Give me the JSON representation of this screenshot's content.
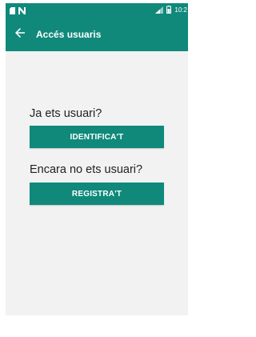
{
  "status_bar": {
    "time": "10:2",
    "icons": [
      "sd-card-icon",
      "no-signal-icon",
      "signal-icon",
      "battery-icon"
    ]
  },
  "app_bar": {
    "back_icon": "arrow-left-icon",
    "title": "Accés usuaris"
  },
  "login_section": {
    "label": "Ja ets usuari?",
    "button_label": "IDENTIFICA'T"
  },
  "register_section": {
    "label": "Encara no ets usuari?",
    "button_label": "REGISTRA'T"
  },
  "colors": {
    "primary": "#10897b",
    "background": "#f2f2f2",
    "text": "#222222",
    "on_primary": "#ffffff"
  }
}
